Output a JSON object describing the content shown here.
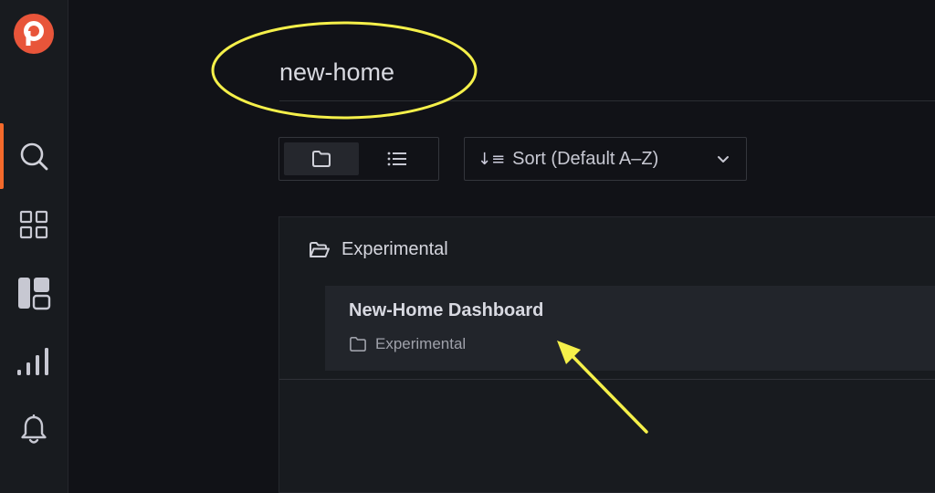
{
  "sidebar": {
    "logo": "grafana-logo",
    "items": [
      {
        "icon": "search-icon",
        "active": true
      },
      {
        "icon": "dashboards-grid-icon",
        "active": false
      },
      {
        "icon": "dashboard-panels-icon",
        "active": false
      },
      {
        "icon": "explore-chart-icon",
        "active": false
      },
      {
        "icon": "bell-icon",
        "active": false
      }
    ],
    "accent_color": "#f46a2b"
  },
  "search": {
    "query": "new-home"
  },
  "toolbar": {
    "view_modes": [
      "folder-view",
      "list-view"
    ],
    "active_view": "folder-view",
    "sort_label": "Sort (Default A–Z)"
  },
  "results": {
    "folder_name": "Experimental",
    "items": [
      {
        "title": "New-Home Dashboard",
        "folder": "Experimental"
      }
    ]
  },
  "annotations": {
    "highlight_color": "#f5f04a"
  }
}
